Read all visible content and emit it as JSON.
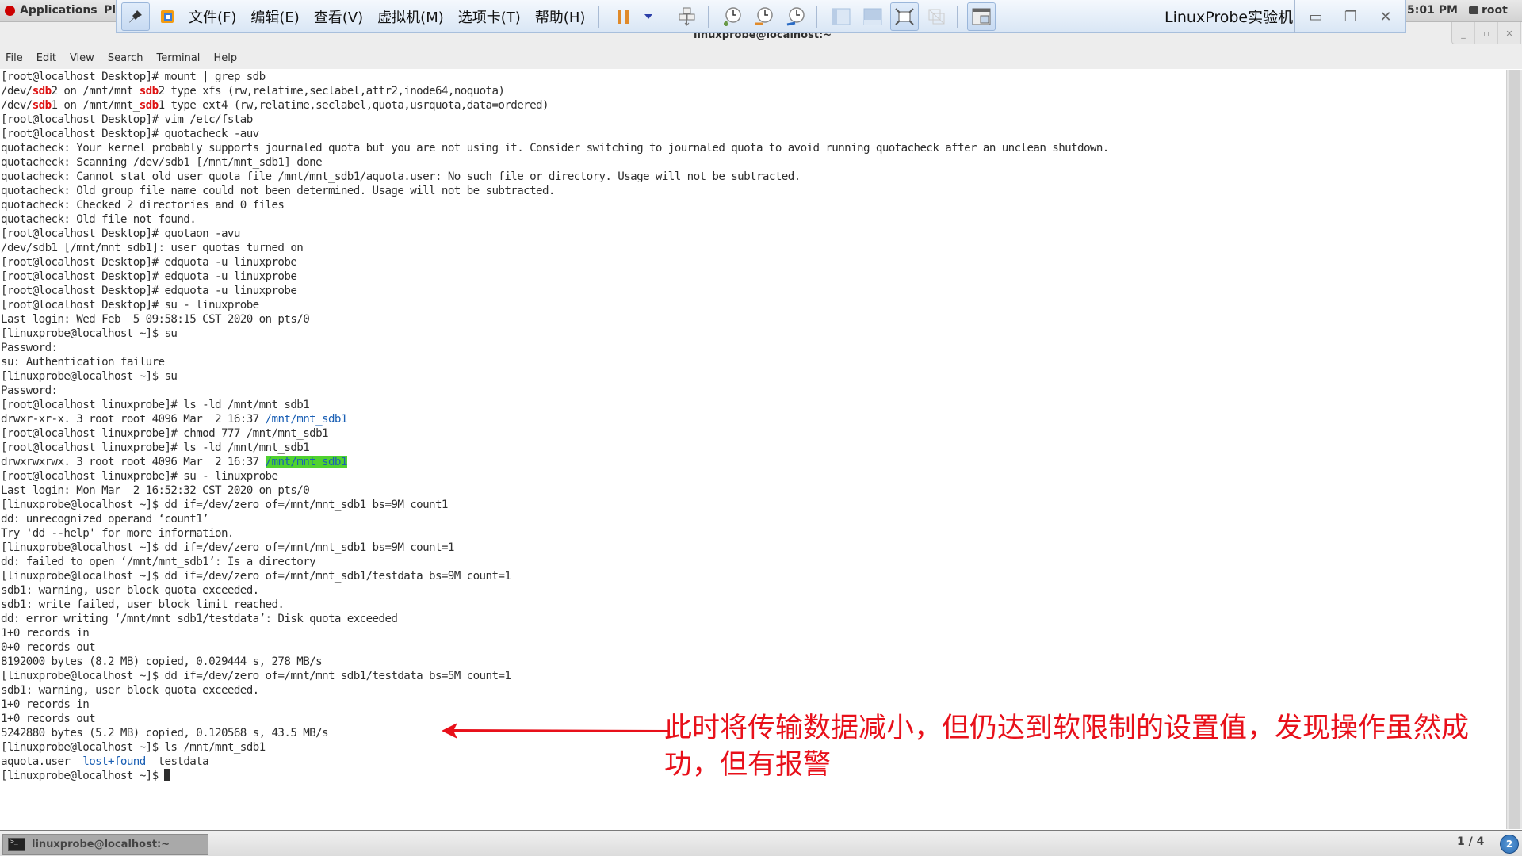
{
  "gnome_topbar": {
    "applications_label": "Applications",
    "places_fragment": "Pl",
    "clock": "5:01 PM",
    "user": "root"
  },
  "vmware": {
    "menus": [
      "文件(F)",
      "编辑(E)",
      "查看(V)",
      "虚拟机(M)",
      "选项卡(T)",
      "帮助(H)"
    ],
    "title": "LinuxProbe实验机",
    "icons": [
      "pin-icon",
      "vmware-logo-icon",
      "pause-icon",
      "dropdown-arrow-icon",
      "send-ctrl-alt-del-icon",
      "snapshot-take-icon",
      "snapshot-revert-icon",
      "snapshot-manager-icon",
      "sidebar-view-icon",
      "console-view-icon",
      "fullscreen-icon",
      "unity-icon",
      "thumbnail-view-icon"
    ]
  },
  "terminal": {
    "window_title": "linuxprobe@localhost:~",
    "menu": [
      "File",
      "Edit",
      "View",
      "Search",
      "Terminal",
      "Help"
    ],
    "lines": [
      [
        {
          "t": "[root@localhost Desktop]# mount | grep sdb"
        }
      ],
      [
        {
          "t": "/dev/"
        },
        {
          "t": "sdb",
          "c": "red"
        },
        {
          "t": "2 on /mnt/mnt_"
        },
        {
          "t": "sdb",
          "c": "red"
        },
        {
          "t": "2 type xfs (rw,relatime,seclabel,attr2,inode64,noquota)"
        }
      ],
      [
        {
          "t": "/dev/"
        },
        {
          "t": "sdb",
          "c": "red"
        },
        {
          "t": "1 on /mnt/mnt_"
        },
        {
          "t": "sdb",
          "c": "red"
        },
        {
          "t": "1 type ext4 (rw,relatime,seclabel,quota,usrquota,data=ordered)"
        }
      ],
      [
        {
          "t": "[root@localhost Desktop]# vim /etc/fstab"
        }
      ],
      [
        {
          "t": "[root@localhost Desktop]# quotacheck -auv"
        }
      ],
      [
        {
          "t": "quotacheck: Your kernel probably supports journaled quota but you are not using it. Consider switching to journaled quota to avoid running quotacheck after an unclean shutdown."
        }
      ],
      [
        {
          "t": "quotacheck: Scanning /dev/sdb1 [/mnt/mnt_sdb1] done"
        }
      ],
      [
        {
          "t": "quotacheck: Cannot stat old user quota file /mnt/mnt_sdb1/aquota.user: No such file or directory. Usage will not be subtracted."
        }
      ],
      [
        {
          "t": "quotacheck: Old group file name could not been determined. Usage will not be subtracted."
        }
      ],
      [
        {
          "t": "quotacheck: Checked 2 directories and 0 files"
        }
      ],
      [
        {
          "t": "quotacheck: Old file not found."
        }
      ],
      [
        {
          "t": "[root@localhost Desktop]# quotaon -avu"
        }
      ],
      [
        {
          "t": "/dev/sdb1 [/mnt/mnt_sdb1]: user quotas turned on"
        }
      ],
      [
        {
          "t": "[root@localhost Desktop]# edquota -u linuxprobe"
        }
      ],
      [
        {
          "t": "[root@localhost Desktop]# edquota -u linuxprobe"
        }
      ],
      [
        {
          "t": "[root@localhost Desktop]# edquota -u linuxprobe"
        }
      ],
      [
        {
          "t": "[root@localhost Desktop]# su - linuxprobe"
        }
      ],
      [
        {
          "t": "Last login: Wed Feb  5 09:58:15 CST 2020 on pts/0"
        }
      ],
      [
        {
          "t": "[linuxprobe@localhost ~]$ su"
        }
      ],
      [
        {
          "t": "Password:"
        }
      ],
      [
        {
          "t": "su: Authentication failure"
        }
      ],
      [
        {
          "t": "[linuxprobe@localhost ~]$ su"
        }
      ],
      [
        {
          "t": "Password:"
        }
      ],
      [
        {
          "t": "[root@localhost linuxprobe]# ls -ld /mnt/mnt_sdb1"
        }
      ],
      [
        {
          "t": "drwxr-xr-x. 3 root root 4096 Mar  2 16:37 "
        },
        {
          "t": "/mnt/mnt_sdb1",
          "c": "blue"
        }
      ],
      [
        {
          "t": "[root@localhost linuxprobe]# chmod 777 /mnt/mnt_sdb1"
        }
      ],
      [
        {
          "t": "[root@localhost linuxprobe]# ls -ld /mnt/mnt_sdb1"
        }
      ],
      [
        {
          "t": "drwxrwxrwx. 3 root root 4096 Mar  2 16:37 "
        },
        {
          "t": "/mnt/mnt_sdb1",
          "c": "hl"
        }
      ],
      [
        {
          "t": "[root@localhost linuxprobe]# su - linuxprobe"
        }
      ],
      [
        {
          "t": "Last login: Mon Mar  2 16:52:32 CST 2020 on pts/0"
        }
      ],
      [
        {
          "t": "[linuxprobe@localhost ~]$ dd if=/dev/zero of=/mnt/mnt_sdb1 bs=9M count1"
        }
      ],
      [
        {
          "t": "dd: unrecognized operand ‘count1’"
        }
      ],
      [
        {
          "t": "Try 'dd --help' for more information."
        }
      ],
      [
        {
          "t": "[linuxprobe@localhost ~]$ dd if=/dev/zero of=/mnt/mnt_sdb1 bs=9M count=1"
        }
      ],
      [
        {
          "t": "dd: failed to open ‘/mnt/mnt_sdb1’: Is a directory"
        }
      ],
      [
        {
          "t": "[linuxprobe@localhost ~]$ dd if=/dev/zero of=/mnt/mnt_sdb1/testdata bs=9M count=1"
        }
      ],
      [
        {
          "t": "sdb1: warning, user block quota exceeded."
        }
      ],
      [
        {
          "t": "sdb1: write failed, user block limit reached."
        }
      ],
      [
        {
          "t": "dd: error writing ‘/mnt/mnt_sdb1/testdata’: Disk quota exceeded"
        }
      ],
      [
        {
          "t": "1+0 records in"
        }
      ],
      [
        {
          "t": "0+0 records out"
        }
      ],
      [
        {
          "t": "8192000 bytes (8.2 MB) copied, 0.029444 s, 278 MB/s"
        }
      ],
      [
        {
          "t": "[linuxprobe@localhost ~]$ dd if=/dev/zero of=/mnt/mnt_sdb1/testdata bs=5M count=1"
        }
      ],
      [
        {
          "t": "sdb1: warning, user block quota exceeded."
        }
      ],
      [
        {
          "t": "1+0 records in"
        }
      ],
      [
        {
          "t": "1+0 records out"
        }
      ],
      [
        {
          "t": "5242880 bytes (5.2 MB) copied, 0.120568 s, 43.5 MB/s"
        }
      ],
      [
        {
          "t": "[linuxprobe@localhost ~]$ ls /mnt/mnt_sdb1"
        }
      ],
      [
        {
          "t": "aquota.user  "
        },
        {
          "t": "lost+found",
          "c": "blue"
        },
        {
          "t": "  testdata"
        }
      ],
      [
        {
          "t": "[linuxprobe@localhost ~]$ "
        },
        {
          "t": "",
          "c": "cursor"
        }
      ]
    ]
  },
  "annotation": {
    "text": "此时将传输数据减小，但仍达到软限制的设置值，发现操作虽然成功，但有报警",
    "color": "#e8101a"
  },
  "taskbar": {
    "task_label": "linuxprobe@localhost:~",
    "workspace": "1 / 4",
    "notification_count": "2"
  }
}
